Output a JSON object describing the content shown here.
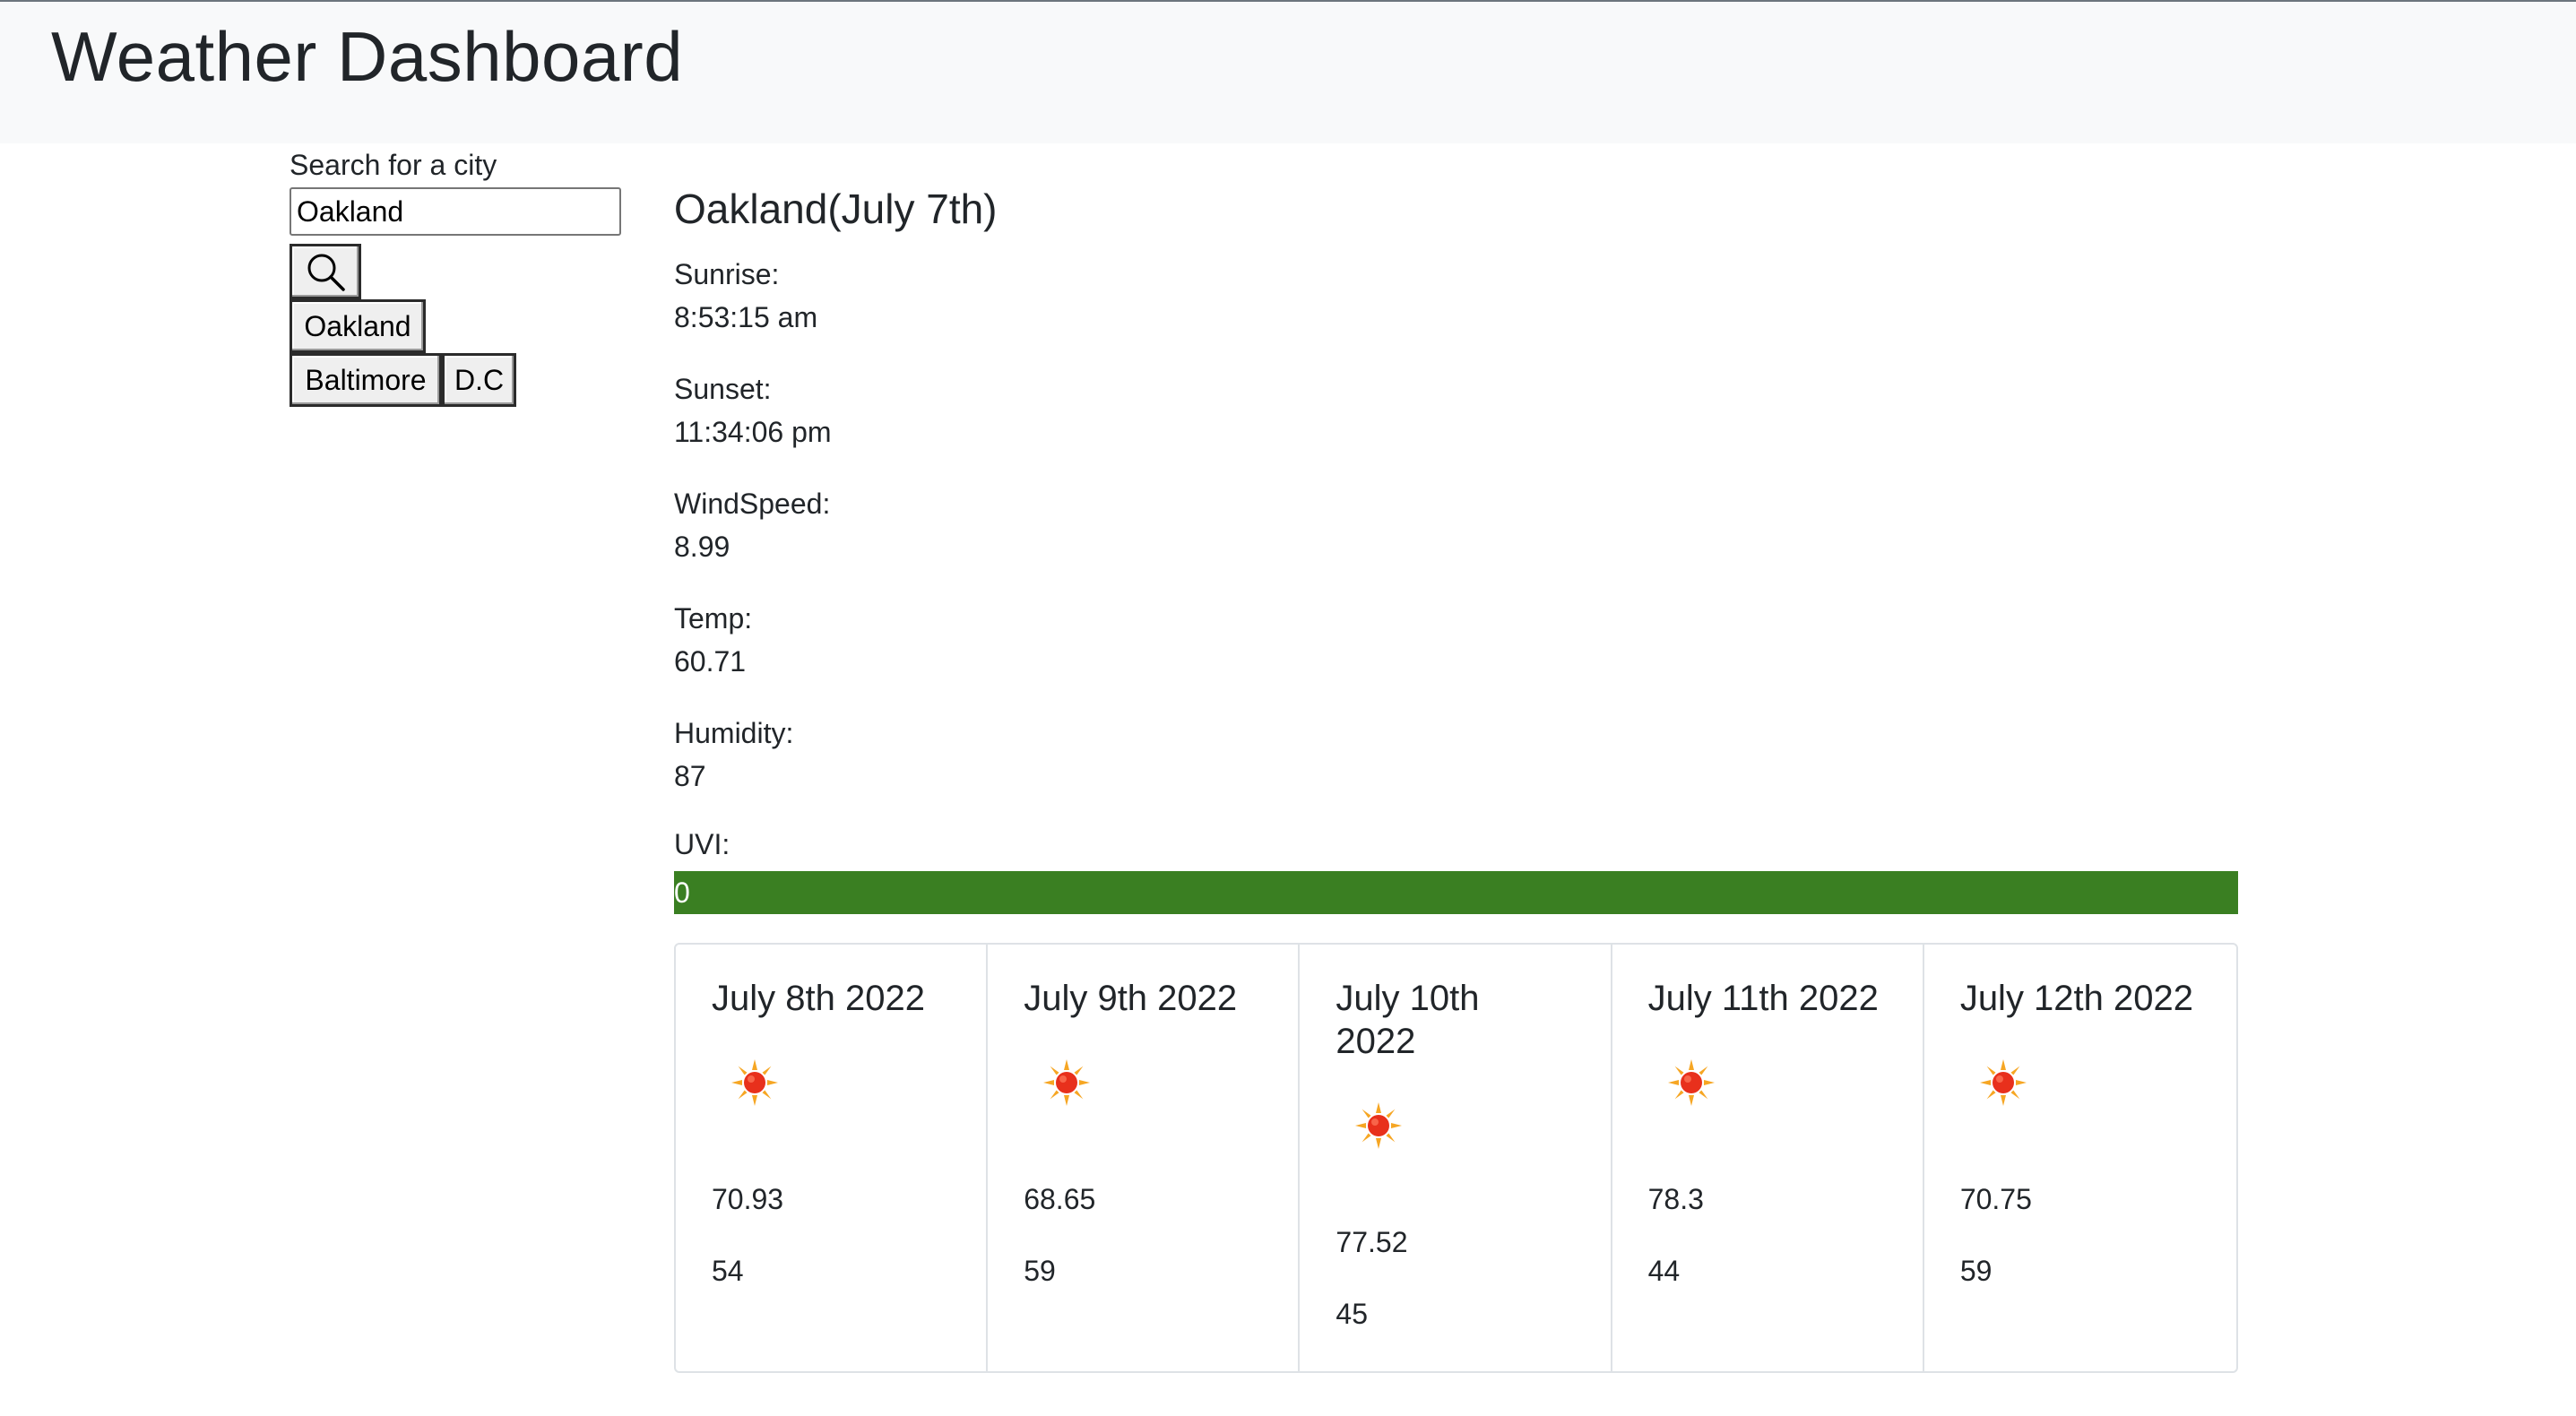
{
  "header": {
    "title": "Weather Dashboard"
  },
  "search": {
    "label": "Search for a city",
    "value": "Oakland",
    "placeholder": "",
    "button_icon": "search-icon"
  },
  "history": [
    "Oakland",
    "Baltimore",
    "D.C"
  ],
  "current": {
    "title": "Oakland(July 7th)",
    "sunrise_label": "Sunrise:",
    "sunrise": "8:53:15 am",
    "sunset_label": "Sunset:",
    "sunset": "11:34:06 pm",
    "wind_label": "WindSpeed:",
    "wind": "8.99",
    "temp_label": "Temp:",
    "temp": "60.71",
    "humidity_label": "Humidity:",
    "humidity": "87",
    "uvi_label": "UVI:",
    "uvi": "0",
    "uvi_color": "#3a7f22"
  },
  "forecast": [
    {
      "date": "July 8th 2022",
      "icon": "sun-icon",
      "temp": "70.93",
      "humidity": "54"
    },
    {
      "date": "July 9th 2022",
      "icon": "sun-icon",
      "temp": "68.65",
      "humidity": "59"
    },
    {
      "date": "July 10th 2022",
      "icon": "sun-icon",
      "temp": "77.52",
      "humidity": "45"
    },
    {
      "date": "July 11th 2022",
      "icon": "sun-icon",
      "temp": "78.3",
      "humidity": "44"
    },
    {
      "date": "July 12th 2022",
      "icon": "sun-icon",
      "temp": "70.75",
      "humidity": "59"
    }
  ]
}
